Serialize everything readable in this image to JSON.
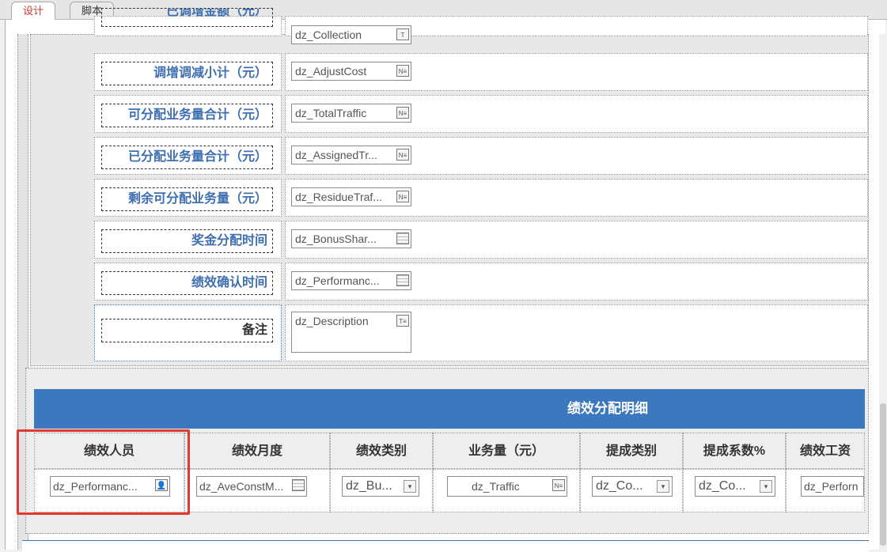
{
  "tabs": [
    {
      "label": "设计",
      "active": true
    },
    {
      "label": "脚本",
      "active": false
    }
  ],
  "form_rows": [
    {
      "label": "已调增金额（元）",
      "field": "dz_Collection",
      "icon": "text-icon",
      "label_color": "#3e6fb0"
    },
    {
      "label": "调增调减小计（元）",
      "field": "dz_AdjustCost",
      "icon": "number-icon",
      "label_color": "#3e6fb0"
    },
    {
      "label": "可分配业务量合计（元）",
      "field": "dz_TotalTraffic",
      "icon": "number-icon",
      "label_color": "#3e6fb0"
    },
    {
      "label": "已分配业务量合计（元）",
      "field": "dz_AssignedTr...",
      "icon": "number-icon",
      "label_color": "#3e6fb0"
    },
    {
      "label": "剩余可分配业务量（元）",
      "field": "dz_ResidueTraf...",
      "icon": "number-icon",
      "label_color": "#3e6fb0"
    },
    {
      "label": "奖金分配时间",
      "field": "dz_BonusShar...",
      "icon": "calendar-icon",
      "label_color": "#3e6fb0"
    },
    {
      "label": "绩效确认时间",
      "field": "dz_Performanc...",
      "icon": "calendar-icon",
      "label_color": "#3e6fb0"
    },
    {
      "label": "备注",
      "field": "dz_Description",
      "icon": "textarea-icon",
      "label_color": "#333333"
    }
  ],
  "detail": {
    "title": "绩效分配明细",
    "headers": [
      "绩效人员",
      "绩效月度",
      "绩效类别",
      "业务量（元）",
      "提成类别",
      "提成系数%",
      "绩效工资"
    ],
    "cells": [
      {
        "value": "dz_Performanc...",
        "icon": "person-icon"
      },
      {
        "value": "dz_AveConstM...",
        "icon": "calendar-icon"
      },
      {
        "value": "dz_Bu...",
        "icon": "dropdown-icon"
      },
      {
        "value": "dz_Traffic",
        "icon": "number-icon"
      },
      {
        "value": "dz_Co...",
        "icon": "dropdown-icon"
      },
      {
        "value": "dz_Co...",
        "icon": "dropdown-icon"
      },
      {
        "value": "dz_Perforn",
        "icon": "none"
      }
    ]
  },
  "colors": {
    "accent": "#3c78bd",
    "label_blue": "#3e6fb0",
    "highlight": "#e23a2e"
  }
}
